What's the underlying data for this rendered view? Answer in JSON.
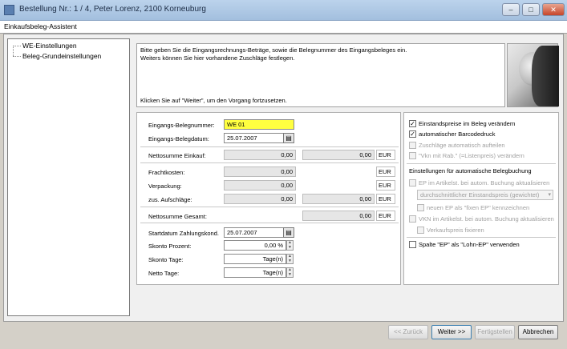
{
  "window": {
    "title": "Bestellung Nr.: 1 / 4, Peter Lorenz, 2100  Korneuburg",
    "minimize_label": "–",
    "maximize_label": "□",
    "close_label": "✕"
  },
  "wizard": {
    "title": "Einkaufsbeleg-Assistent"
  },
  "tree": {
    "items": [
      {
        "label": "WE-Einstellungen"
      },
      {
        "label": "Beleg-Grundeinstellungen"
      }
    ]
  },
  "info": {
    "line1": "Bitte geben Sie die Eingangsrechnungs-Beträge, sowie die Belegnummer des Eingangsbeleges ein.",
    "line2": "Weiters können Sie hier vorhandene Zuschläge festlegen.",
    "hint": "Klicken Sie auf \"Weiter\", um den Vorgang fortzusetzen."
  },
  "form": {
    "belegnummer_label": "Eingangs-Belegnummer:",
    "belegnummer_value": "WE 01",
    "belegdatum_label": "Eingangs-Belegdatum:",
    "belegdatum_value": "25.07.2007",
    "netto_einkauf_label": "Nettosumme Einkauf:",
    "netto_einkauf_value1": "0,00",
    "netto_einkauf_value2": "0,00",
    "netto_einkauf_unit": "EUR",
    "fracht_label": "Frachtkosten:",
    "fracht_value": "0,00",
    "fracht_unit": "EUR",
    "verpackung_label": "Verpackung:",
    "verpackung_value": "0,00",
    "verpackung_unit": "EUR",
    "aufschlaege_label": "zus. Aufschläge:",
    "aufschlaege_value1": "0,00",
    "aufschlaege_value2": "0,00",
    "aufschlaege_unit": "EUR",
    "netto_gesamt_label": "Nettosumme Gesamt:",
    "netto_gesamt_value": "0,00",
    "netto_gesamt_unit": "EUR",
    "startdatum_label": "Startdatum Zahlungskond.",
    "startdatum_value": "25.07.2007",
    "skonto_prozent_label": "Skonto Prozent:",
    "skonto_prozent_value": "0,00 %",
    "skonto_tage_label": "Skonto Tage:",
    "skonto_tage_value": "Tage(n)",
    "netto_tage_label": "Netto Tage:",
    "netto_tage_value": "Tage(n)",
    "calendar_glyph": "▤",
    "spin_up": "▲",
    "spin_down": "▼"
  },
  "options": {
    "einstandspreise": {
      "label": "Einstandspreise im Beleg verändern",
      "checked": true
    },
    "barcodedruck": {
      "label": "automatischer Barcodedruck",
      "checked": true
    },
    "zuschlaege": {
      "label": "Zuschläge automatisch aufteilen",
      "checked": false
    },
    "vkn": {
      "label": "\"Vkn mit Rab.\" (=Listenpreis) verändern",
      "checked": false
    },
    "group_title": "Einstellungen für automatische Belegbuchung",
    "ep_artikel": {
      "label": "EP im Artikelst. bei autom. Buchung aktualisieren",
      "checked": false
    },
    "ep_select": "durchschnittlicher Einstandspreis (gewichtet)",
    "select_arrow": "▾",
    "neuer_ep": {
      "label": "neuen EP als \"fixen EP\" kennzeichnen",
      "checked": false
    },
    "vkn_artikel": {
      "label": "VKN im Artikelst. bei autom. Buchung aktualisieren",
      "checked": false
    },
    "verkaufspreis": {
      "label": "Verkaufspreis fixieren",
      "checked": false
    },
    "spalte_ep": {
      "label": "Spalte \"EP\" als \"Lohn-EP\" verwenden",
      "checked": false
    },
    "check_glyph": "✓"
  },
  "buttons": {
    "back": "<< Zurück",
    "next": "Weiter >>",
    "finish": "Fertigstellen",
    "cancel": "Abbrechen"
  },
  "colors": {
    "highlight_field": "#ffff40",
    "titlebar": "#bcd3ec",
    "close_button": "#c6452a"
  }
}
